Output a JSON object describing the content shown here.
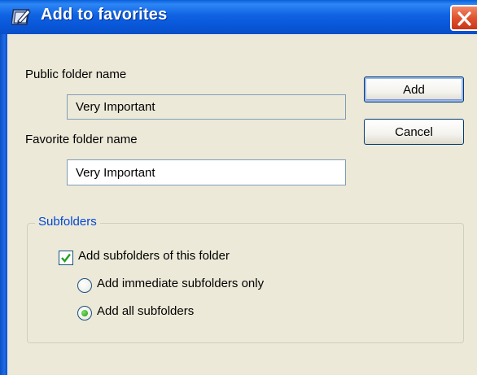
{
  "dialog": {
    "title": "Add to favorites"
  },
  "form": {
    "public_folder_label": "Public folder name",
    "public_folder_value": "Very Important",
    "favorite_folder_label": "Favorite folder name",
    "favorite_folder_value": "Very Important"
  },
  "buttons": {
    "add_label": "Add",
    "cancel_label": "Cancel"
  },
  "subfolders": {
    "group_label": "Subfolders",
    "add_subfolders_label": "Add subfolders of this folder",
    "add_subfolders_checked": true,
    "immediate_only_label": "Add immediate subfolders only",
    "all_subfolders_label": "Add all subfolders",
    "selected_option": "all"
  },
  "icons": {
    "title_icon": "favorites-folder-icon",
    "close_icon": "close-icon",
    "check_icon": "checkmark-icon"
  },
  "colors": {
    "titlebar": "#0755d6",
    "close_button": "#e0532f",
    "group_label": "#0046d5",
    "checkmark": "#21a121",
    "radio_selected": "#1f9a14"
  }
}
